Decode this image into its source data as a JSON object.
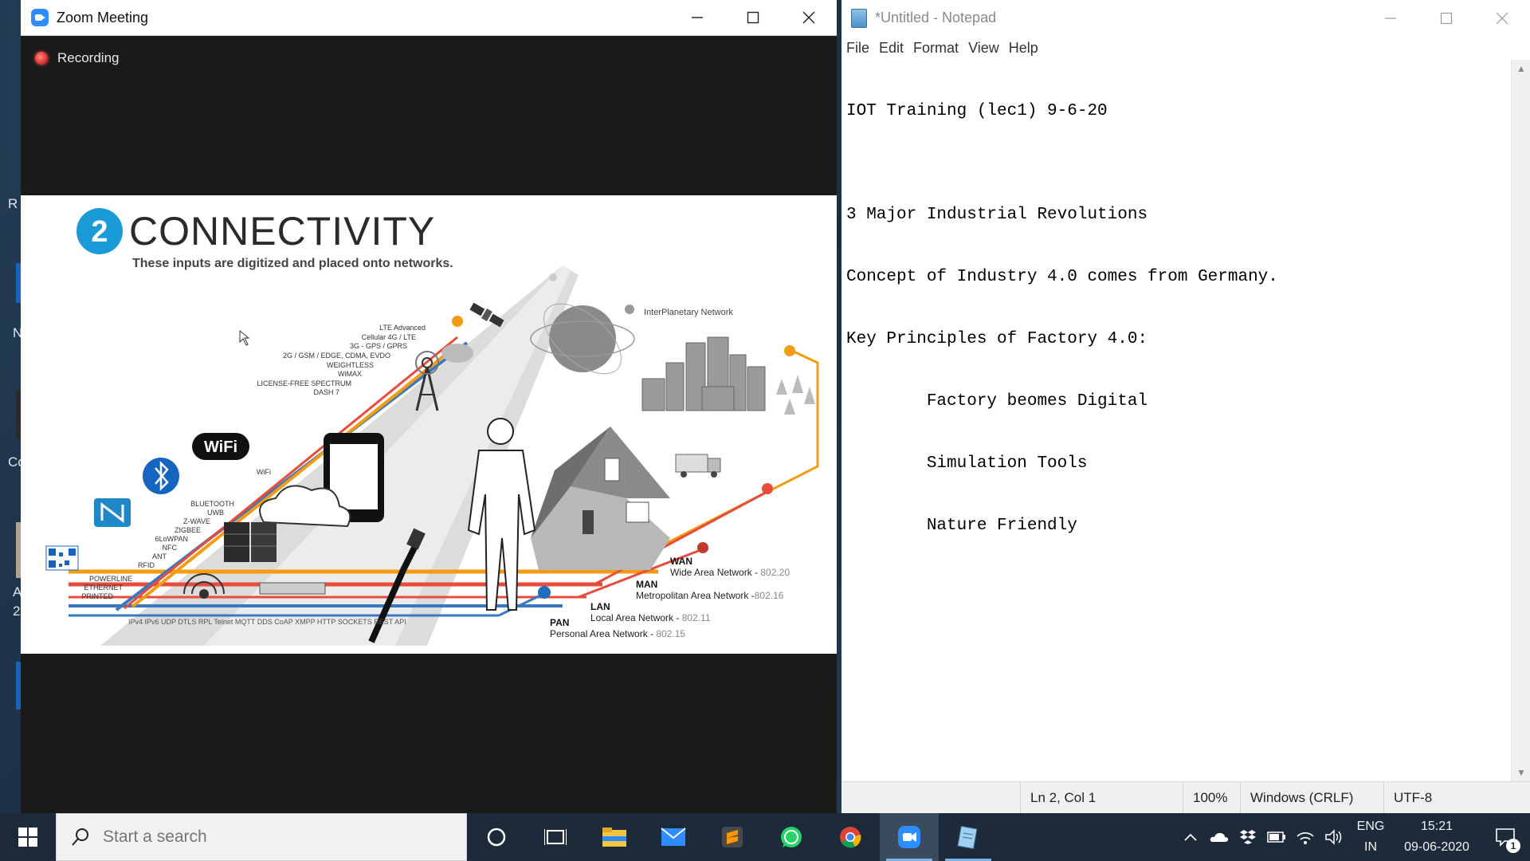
{
  "zoom": {
    "title": "Zoom Meeting",
    "recording_label": "Recording"
  },
  "slide": {
    "number": "2",
    "title": "CONNECTIVITY",
    "subtitle": "These inputs are digitized and placed onto networks.",
    "interplanetary": "InterPlanetary Network",
    "cellular_list": [
      "LTE Advanced",
      "Cellular 4G / LTE",
      "3G - GPS / GPRS",
      "2G / GSM / EDGE, CDMA, EVDO",
      "WEIGHTLESS",
      "WiMAX",
      "LICENSE-FREE SPECTRUM",
      "DASH 7"
    ],
    "wifi_logo": "WiFi",
    "wifi_label": "WiFi",
    "short_range_list": [
      "BLUETOOTH",
      "UWB",
      "Z-WAVE",
      "ZIGBEE",
      "6LoWPAN",
      "NFC",
      "ANT",
      "RFID"
    ],
    "wired_list": [
      "POWERLINE",
      "ETHERNET",
      "PRINTED"
    ],
    "protocols": "IPv4 IPv6 UDP DTLS RPL Telnet MQTT DDS CoAP XMPP HTTP SOCKETS REST API",
    "networks": [
      {
        "abbr": "WAN",
        "name": "Wide Area Network",
        "std": "802.20"
      },
      {
        "abbr": "MAN",
        "name": "Metropolitan Area Network",
        "std": "802.16"
      },
      {
        "abbr": "LAN",
        "name": "Local Area Network",
        "std": "802.11"
      },
      {
        "abbr": "PAN",
        "name": "Personal Area Network",
        "std": "802.15"
      }
    ],
    "network_colors": {
      "wan": "#f39c12",
      "man": "#e74c3c",
      "lan": "#3a78c2",
      "pan": "#3a78c2"
    }
  },
  "notepad": {
    "title": "*Untitled - Notepad",
    "menu": [
      "File",
      "Edit",
      "Format",
      "View",
      "Help"
    ],
    "lines": [
      "IOT Training (lec1) 9-6-20",
      "",
      "3 Major Industrial Revolutions",
      "Concept of Industry 4.0 comes from Germany.",
      "Key Principles of Factory 4.0:",
      "        Factory beomes Digital",
      "        Simulation Tools",
      "        Nature Friendly"
    ],
    "status": {
      "position": "Ln 2, Col 1",
      "zoom": "100%",
      "line_ending": "Windows (CRLF)",
      "encoding": "UTF-8"
    }
  },
  "desktop_fragments": [
    "R",
    "N",
    "Co",
    "A",
    "2"
  ],
  "taskbar": {
    "search_placeholder": "Start a search",
    "apps": [
      "cortana-icon",
      "task-view-icon",
      "file-explorer-icon",
      "mail-icon",
      "sublime-text-icon",
      "whatsapp-icon",
      "chrome-icon",
      "zoom-icon",
      "notepad-icon"
    ],
    "lang_top": "ENG",
    "lang_bottom": "IN",
    "time": "15:21",
    "date": "09-06-2020",
    "notification_count": "1"
  }
}
